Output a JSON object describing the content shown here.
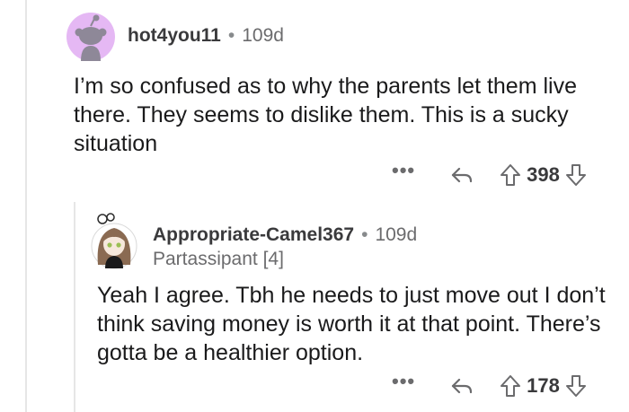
{
  "comments": [
    {
      "username": "hot4you11",
      "separator": "•",
      "age": "109d",
      "body": "I’m so confused as to why the parents let them live there. They seems to dislike them. This is a sucky situation",
      "score": "398",
      "more_label": "•••"
    },
    {
      "username": "Appropriate-Camel367",
      "separator": "•",
      "age": "109d",
      "flair": "Partassipant [4]",
      "body": "Yeah I agree. Tbh he needs to just move out I don’t think saving money is worth it at that point. There’s gotta be a healthier option.",
      "score": "178",
      "more_label": "•••"
    }
  ],
  "icons": {
    "reply": "reply-arrow",
    "upvote": "arrow-up-outline",
    "downvote": "arrow-down-outline",
    "more": "ellipsis",
    "avatar_default": "snoo-silhouette",
    "avatar_custom": "girl-avatar"
  },
  "colors": {
    "avatar_bg": "#e5b8f4",
    "avatar_figure": "#8e8898",
    "thread_line": "#e6e6e6",
    "meta_gray": "#6b6b6d"
  }
}
